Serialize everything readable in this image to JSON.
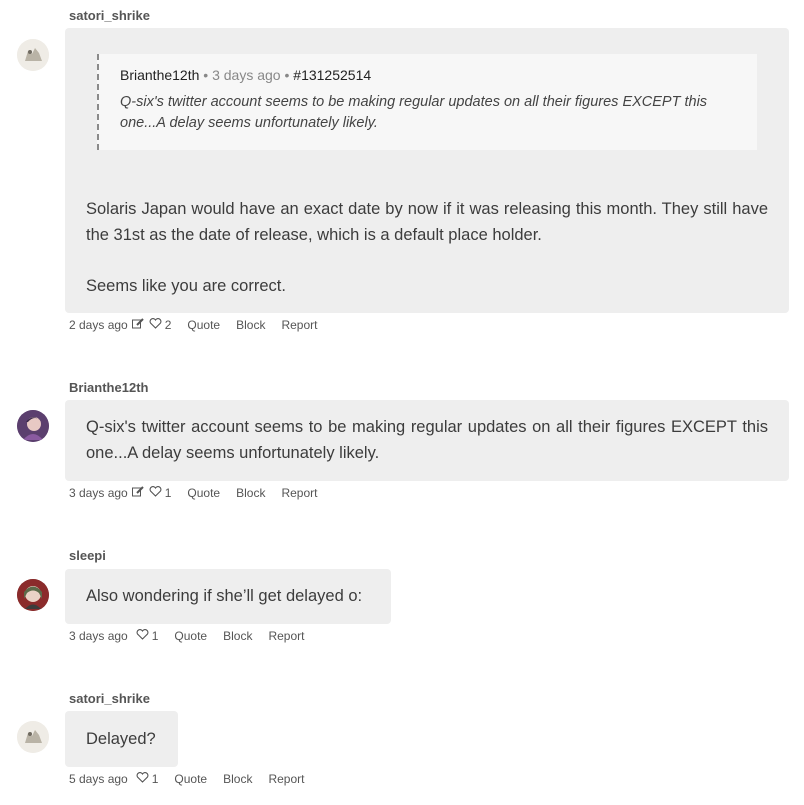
{
  "comments": [
    {
      "username": "satori_shrike",
      "quote": {
        "author": "Brianthe12th",
        "time": "3 days ago",
        "id": "#131252514",
        "text": "Q-six's twitter account seems to be making regular updates on all their figures EXCEPT this one...A delay seems unfortunately likely."
      },
      "paragraphs": [
        "Solaris Japan would have an exact date by now if it was releasing this month. They still have the 31st as the date of release, which is a default place holder.",
        "Seems like you are correct."
      ],
      "time": "2 days ago",
      "likes": "2",
      "actions": [
        "Quote",
        "Block",
        "Report"
      ]
    },
    {
      "username": "Brianthe12th",
      "paragraphs": [
        "Q-six's twitter account seems to be making regular updates on all their figures EXCEPT this one...A delay seems unfortunately likely."
      ],
      "time": "3 days ago",
      "likes": "1",
      "actions": [
        "Quote",
        "Block",
        "Report"
      ]
    },
    {
      "username": "sleepi",
      "paragraphs": [
        "Also wondering if she’ll get delayed o:"
      ],
      "time": "3 days ago",
      "likes": "1",
      "actions": [
        "Quote",
        "Block",
        "Report"
      ]
    },
    {
      "username": "satori_shrike",
      "paragraphs": [
        "Delayed?"
      ],
      "time": "5 days ago",
      "likes": "1",
      "actions": [
        "Quote",
        "Block",
        "Report"
      ]
    }
  ],
  "icons": {
    "edit": "edit-icon",
    "like": "heart-icon"
  },
  "colors": {
    "bubble": "#eeeeee",
    "quote_bg": "#f7f7f7",
    "username": "#555555"
  }
}
